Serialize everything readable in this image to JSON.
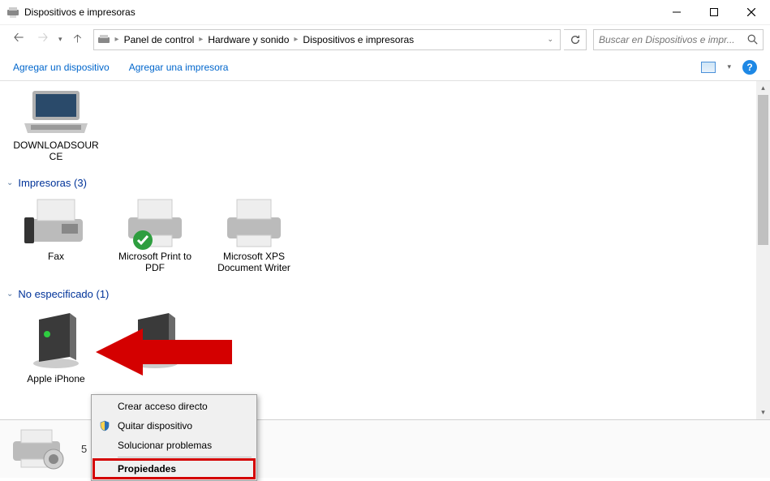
{
  "window": {
    "title": "Dispositivos e impresoras"
  },
  "breadcrumbs": {
    "items": [
      "Panel de control",
      "Hardware y sonido",
      "Dispositivos e impresoras"
    ]
  },
  "search": {
    "placeholder": "Buscar en Dispositivos e impr..."
  },
  "toolbar": {
    "add_device": "Agregar un dispositivo",
    "add_printer": "Agregar una impresora"
  },
  "groups": {
    "devices": {
      "items": [
        {
          "label": "DOWNLOADSOURCE"
        }
      ]
    },
    "printers": {
      "header": "Impresoras (3)",
      "items": [
        {
          "label": "Fax"
        },
        {
          "label": "Microsoft Print to PDF"
        },
        {
          "label": "Microsoft XPS Document Writer"
        }
      ]
    },
    "unspecified": {
      "header": "No especificado (1)",
      "items": [
        {
          "label": "Apple iPhone"
        }
      ]
    }
  },
  "details": {
    "count": "5"
  },
  "context_menu": {
    "create_shortcut": "Crear acceso directo",
    "remove_device": "Quitar dispositivo",
    "troubleshoot": "Solucionar problemas",
    "properties": "Propiedades"
  }
}
